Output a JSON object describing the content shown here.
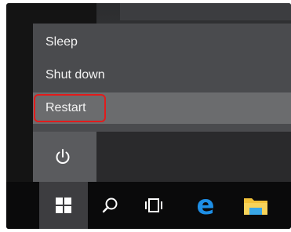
{
  "power_menu": {
    "items": [
      {
        "label": "Sleep"
      },
      {
        "label": "Shut down"
      },
      {
        "label": "Restart",
        "selected": true,
        "annotated": true
      }
    ]
  },
  "icons": {
    "power": "power-icon",
    "start": "windows-logo-icon",
    "search": "search-icon",
    "task_view": "task-view-icon",
    "edge": "edge-browser-icon",
    "explorer": "file-explorer-icon",
    "cursor": "mouse-pointer-icon"
  },
  "colors": {
    "menu_bg": "#4a4b4e",
    "selected_bg": "#6b6c6e",
    "annotation": "#e11c1c",
    "taskbar_bg": "#0a0a0b",
    "edge_blue": "#1e8fe6",
    "folder_yellow": "#f2c23a"
  }
}
